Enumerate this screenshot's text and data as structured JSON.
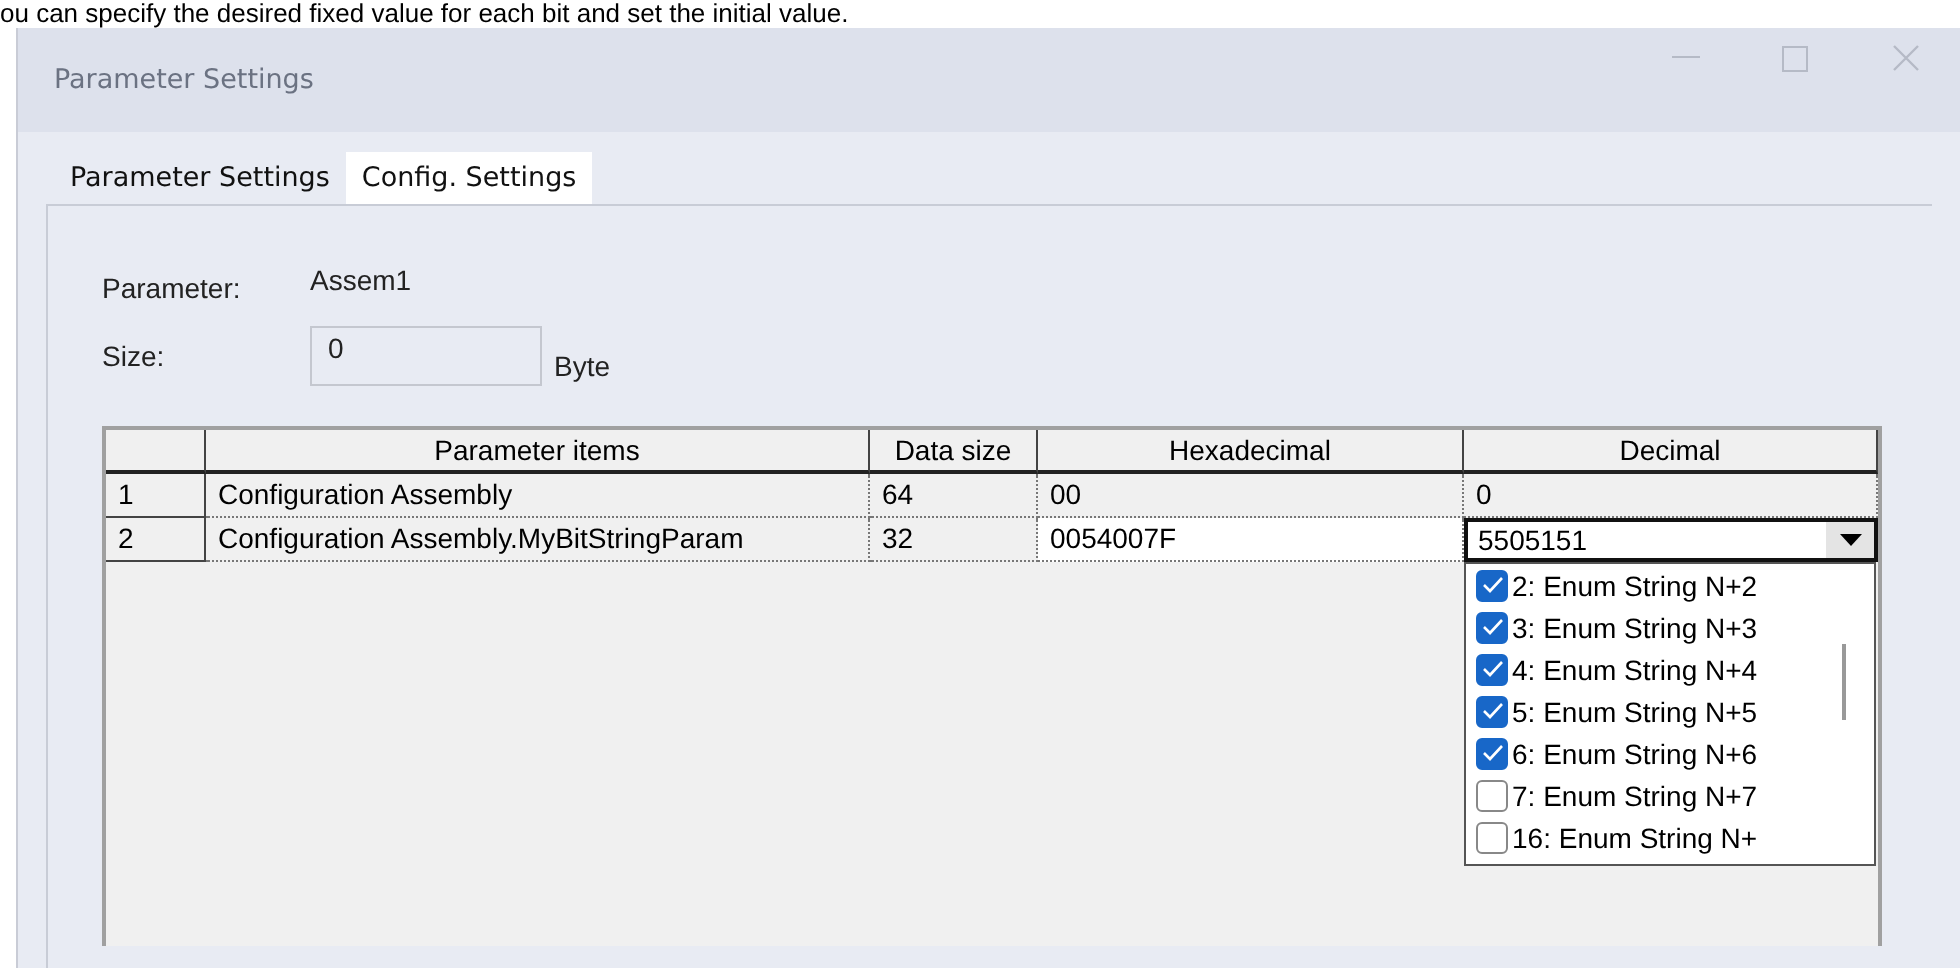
{
  "caption": "ou can specify the desired fixed value for each bit and set the initial value.",
  "window": {
    "title": "Parameter Settings"
  },
  "tabs": [
    {
      "label": "Parameter Settings",
      "selected": false
    },
    {
      "label": "Config. Settings",
      "selected": true
    }
  ],
  "parameter": {
    "label": "Parameter:",
    "value": "Assem1"
  },
  "size": {
    "label": "Size:",
    "value": "0",
    "unit": "Byte"
  },
  "table": {
    "columns": [
      "Parameter items",
      "Data size",
      "Hexadecimal",
      "Decimal"
    ],
    "rows": [
      {
        "index": "1",
        "item": "Configuration Assembly",
        "data_size": "64",
        "hex": "00",
        "decimal": "0",
        "editing": false
      },
      {
        "index": "2",
        "item": "Configuration Assembly.MyBitStringParam",
        "data_size": "32",
        "hex": "0054007F",
        "decimal": "5505151",
        "editing": true
      }
    ]
  },
  "dropdown": {
    "options": [
      {
        "label": "2: Enum String N+2",
        "checked": true
      },
      {
        "label": "3: Enum String N+3",
        "checked": true
      },
      {
        "label": "4: Enum String N+4",
        "checked": true
      },
      {
        "label": "5: Enum String N+5",
        "checked": true
      },
      {
        "label": "6: Enum String N+6",
        "checked": true
      },
      {
        "label": "7: Enum String N+7",
        "checked": false
      },
      {
        "label": "16: Enum String N+",
        "checked": false
      }
    ]
  }
}
